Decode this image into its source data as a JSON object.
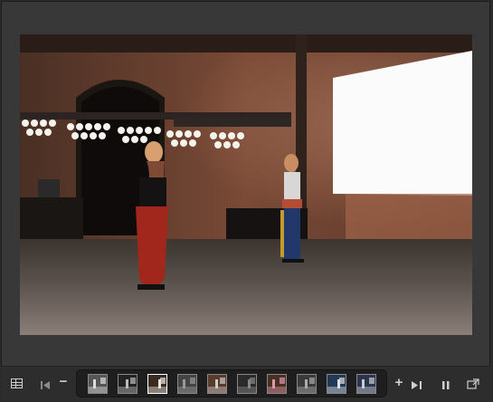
{
  "viewer": {
    "photo_alt": "",
    "selected_index": 2
  },
  "toolbar": {
    "grid_icon": "grid-view-icon",
    "prev_icon": "skip-back-icon",
    "minus_label": "−",
    "plus_label": "+",
    "next_icon": "skip-forward-icon",
    "pause_icon": "pause-icon",
    "fullscreen_icon": "fullscreen-icon"
  },
  "filmstrip": {
    "count": 10
  },
  "colors": {
    "background": "#2b2b2b",
    "panel": "#383838",
    "strip": "#1e1e1e",
    "icon": "#cfcfcf",
    "selected_border": "#ffffff"
  }
}
